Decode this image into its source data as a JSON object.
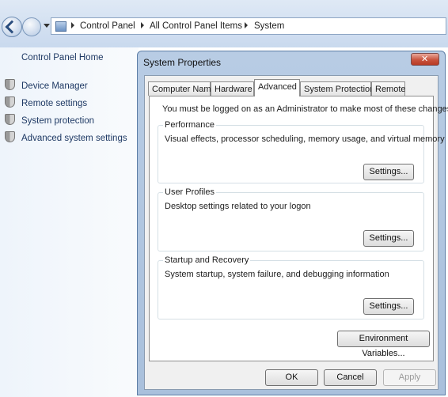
{
  "addressbar": {
    "crumbs": [
      "Control Panel",
      "All Control Panel Items",
      "System"
    ]
  },
  "left_panel": {
    "home": "Control Panel Home",
    "items": [
      "Device Manager",
      "Remote settings",
      "System protection",
      "Advanced system settings"
    ]
  },
  "dialog": {
    "title": "System Properties",
    "tabs": [
      "Computer Name",
      "Hardware",
      "Advanced",
      "System Protection",
      "Remote"
    ],
    "active_tab": "Advanced",
    "intro": "You must be logged on as an Administrator to make most of these changes.",
    "groups": [
      {
        "title": "Performance",
        "description": "Visual effects, processor scheduling, memory usage, and virtual memory",
        "button": "Settings..."
      },
      {
        "title": "User Profiles",
        "description": "Desktop settings related to your logon",
        "button": "Settings..."
      },
      {
        "title": "Startup and Recovery",
        "description": "System startup, system failure, and debugging information",
        "button": "Settings..."
      }
    ],
    "env_button": "Environment Variables...",
    "ok": "OK",
    "cancel": "Cancel",
    "apply": "Apply"
  },
  "colors": {
    "link": "#1e3964",
    "dialog_frame": "#b8cce4",
    "close_button": "#c9533d"
  }
}
